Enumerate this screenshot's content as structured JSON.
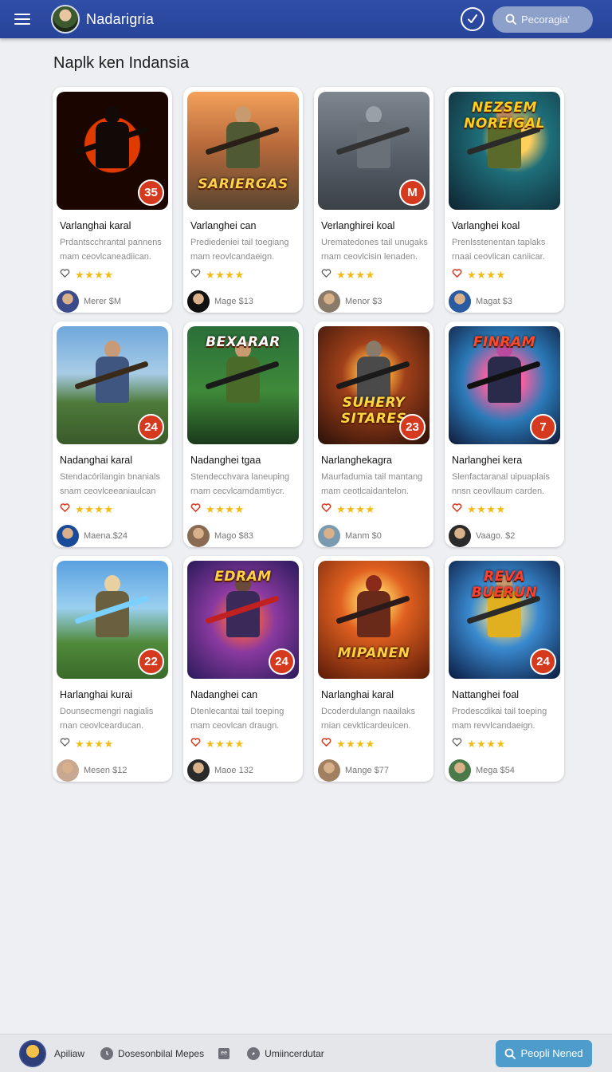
{
  "header": {
    "app_title": "Nadarigria",
    "search_placeholder": "Pecoragia'"
  },
  "page_title": "Naplk ken Indansia",
  "cards": [
    {
      "title": "Varlanghai karal",
      "desc": "Prdantscchrantal pannens mam ceovlcaneadiican.",
      "rating": "★★★★",
      "author": "Merer $M",
      "badge": "35",
      "art": "",
      "heart": "outline"
    },
    {
      "title": "Varlanghei can",
      "desc": "Prediedeniei tail toegiang mam reovlcandaeign.",
      "rating": "★★★★",
      "author": "Mage $13",
      "badge": "",
      "art": "SARIERGAS",
      "heart": "outline"
    },
    {
      "title": "Verlanghirei koal",
      "desc": "Urematedones tail unugaks rnam ceovlcisin lenaden.",
      "rating": "★★★★",
      "author": "Menor $3",
      "badge": "M",
      "art": "",
      "heart": "outline"
    },
    {
      "title": "Varlanghei koal",
      "desc": "Prenlsstenentan taplaks rnaai ceovlican caniicar.",
      "rating": "★★★★",
      "author": "Magat $3",
      "badge": "",
      "art": "NEZSEM NOREIGAL",
      "heart": "red"
    },
    {
      "title": "Nadanghai karal",
      "desc": "Stendacórilangin bnanials snam ceovlceeaniaulcan",
      "rating": "★★★★",
      "author": "Maena.$24",
      "badge": "24",
      "art": "",
      "heart": "red"
    },
    {
      "title": "Nadanghei tgaa",
      "desc": "Stendecchvara laneuping rnam cecvlcamdamtiycr.",
      "rating": "★★★★",
      "author": "Mago $83",
      "badge": "",
      "art": "BEXARAR",
      "heart": "red"
    },
    {
      "title": "Narlanghekagra",
      "desc": "Maurfadumia tail mantang mam ceotlcaidantelon.",
      "rating": "★★★★",
      "author": "Manm $0",
      "badge": "23",
      "art": "SUHERY SITARES",
      "heart": "red"
    },
    {
      "title": "Narlanghei kera",
      "desc": "Slenfactaranal uipuaplais nnsn ceovllaum carden.",
      "rating": "★★★★",
      "author": "Vaago. $2",
      "badge": "7",
      "art": "FINRAM",
      "heart": "red"
    },
    {
      "title": "Harlanghai kurai",
      "desc": "Dounsecmengri nagialis rnan ceovlcearducan.",
      "rating": "★★★★",
      "author": "Mesen $12",
      "badge": "22",
      "art": "",
      "heart": "outline"
    },
    {
      "title": "Nadanghei can",
      "desc": "Dtenlecantai tail toeping mam ceovlcan draugn.",
      "rating": "★★★★",
      "author": "Maoe 132",
      "badge": "24",
      "art": "EDRAM",
      "heart": "red"
    },
    {
      "title": "Narlanghai karal",
      "desc": "Dcoderdulangn naailaks rnian cevkticardeuicen.",
      "rating": "★★★★",
      "author": "Mange $77",
      "badge": "",
      "art": "MIPANEN",
      "heart": "red"
    },
    {
      "title": "Nattanghei foal",
      "desc": "Prodescdikai tail toeping mam revvlcandaeign.",
      "rating": "★★★★",
      "author": "Mega $54",
      "badge": "24",
      "art": "REVA BUERUN",
      "heart": "outline"
    }
  ],
  "bottom": {
    "item1": "Apiliaw",
    "item2": "Dosesonbilal Mepes",
    "item3": "Umiincerdutar",
    "button": "Peopli Nened",
    "square_icon_text": "ee"
  },
  "colors": {
    "header": "#2f4ea6",
    "badge": "#d53a1f",
    "star": "#f2bb16",
    "button": "#4e9ccc"
  }
}
